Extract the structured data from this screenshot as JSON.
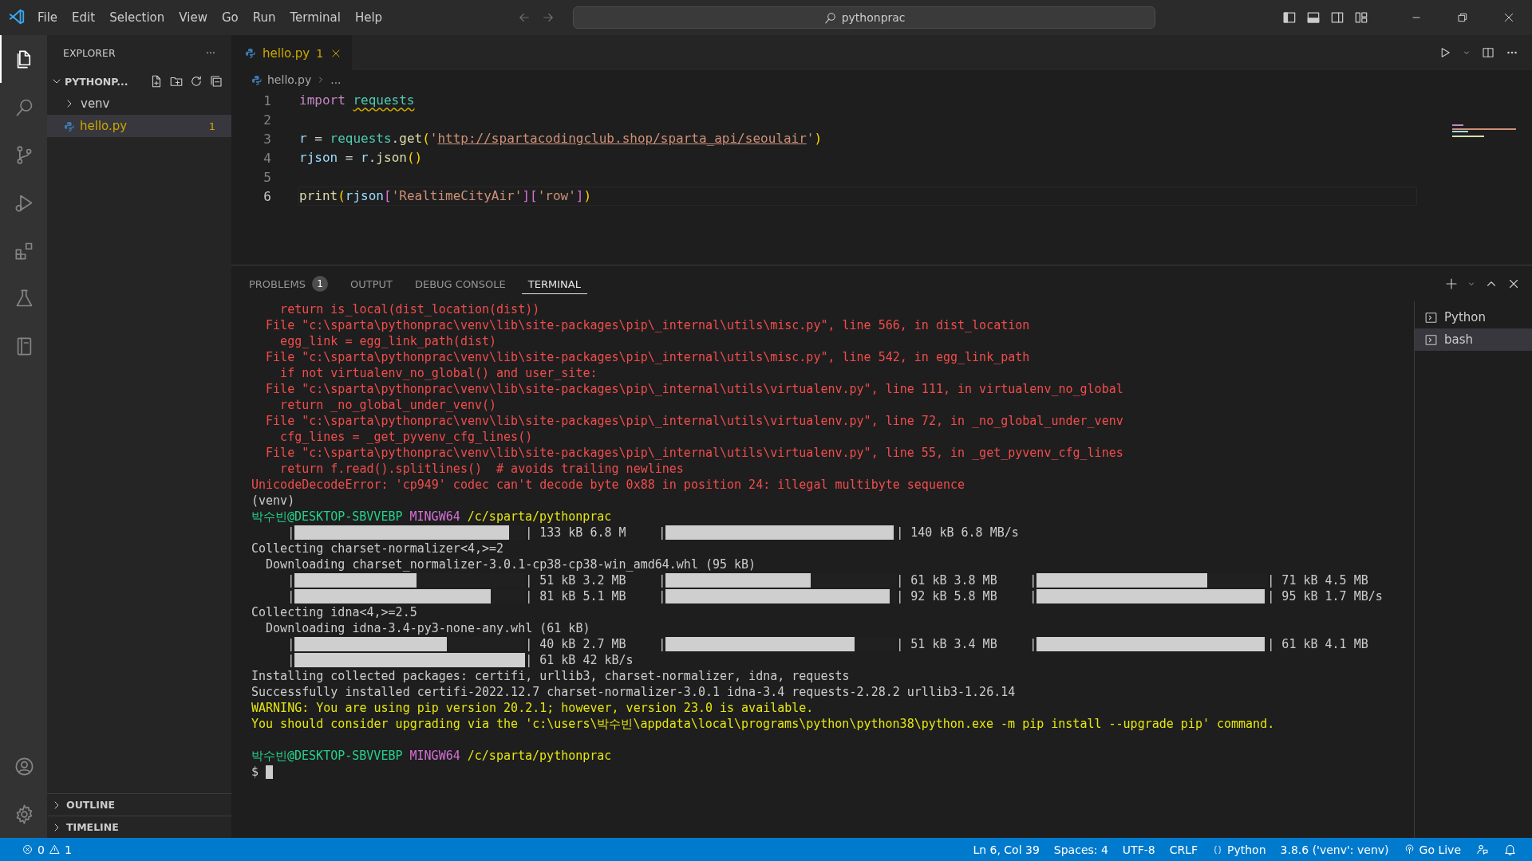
{
  "title_bar": {
    "menu": [
      "File",
      "Edit",
      "Selection",
      "View",
      "Go",
      "Run",
      "Terminal",
      "Help"
    ],
    "search": "pythonprac"
  },
  "activity_bar": {
    "top": [
      {
        "kind": "files",
        "selected": true
      },
      {
        "kind": "search",
        "selected": false
      },
      {
        "kind": "source-control",
        "selected": false
      },
      {
        "kind": "run-debug",
        "selected": false
      },
      {
        "kind": "extensions",
        "selected": false
      },
      {
        "kind": "testing",
        "selected": false
      },
      {
        "kind": "notebook",
        "selected": false
      }
    ],
    "bottom": [
      {
        "kind": "account",
        "selected": false
      },
      {
        "kind": "settings",
        "selected": false
      }
    ]
  },
  "sidebar": {
    "title": "EXPLORER",
    "more": "···",
    "folder": {
      "name": "PYTHONP...",
      "expanded": true
    },
    "tree": [
      {
        "name": "venv",
        "kind": "folder",
        "expanded": false,
        "selected": false
      },
      {
        "name": "hello.py",
        "kind": "python",
        "selected": true,
        "badge": "1"
      }
    ],
    "sections": [
      {
        "name": "OUTLINE",
        "expanded": false
      },
      {
        "name": "TIMELINE",
        "expanded": false
      }
    ]
  },
  "tabs": [
    {
      "label": "hello.py",
      "badge": "1",
      "selected": true
    }
  ],
  "breadcrumb": [
    "hello.py",
    "..."
  ],
  "editor": {
    "lines": [
      {
        "number": "1",
        "selected": false,
        "tokens": [
          {
            "text": "import ",
            "kind": "kw",
            "squiggle": false
          },
          {
            "text": "requests",
            "kind": "module",
            "squiggle": true
          }
        ]
      },
      {
        "number": "2",
        "selected": false
      },
      {
        "number": "3",
        "selected": false,
        "tokens": [
          {
            "text": "r",
            "kind": "var"
          },
          {
            "text": " = ",
            "kind": "plain"
          },
          {
            "text": "requests",
            "kind": "module"
          },
          {
            "text": ".",
            "kind": "plain"
          },
          {
            "text": "get",
            "kind": "fn"
          },
          {
            "text": "(",
            "kind": "bracket"
          },
          {
            "text": "'",
            "kind": "str"
          },
          {
            "text": "http://spartacodingclub.shop/sparta_api/seoulair",
            "kind": "link"
          },
          {
            "text": "'",
            "kind": "str"
          },
          {
            "text": ")",
            "kind": "bracket"
          }
        ]
      },
      {
        "number": "4",
        "selected": false,
        "tokens": [
          {
            "text": "rjson",
            "kind": "var"
          },
          {
            "text": " = ",
            "kind": "plain"
          },
          {
            "text": "r",
            "kind": "var"
          },
          {
            "text": ".",
            "kind": "plain"
          },
          {
            "text": "json",
            "kind": "fn"
          },
          {
            "text": "()",
            "kind": "bracket"
          }
        ]
      },
      {
        "number": "5",
        "selected": false
      },
      {
        "number": "6",
        "selected": true,
        "tokens": [
          {
            "text": "print",
            "kind": "fn"
          },
          {
            "text": "(",
            "kind": "bracket"
          },
          {
            "text": "rjson",
            "kind": "var"
          },
          {
            "text": "[",
            "kind": "bracket2"
          },
          {
            "text": "'RealtimeCityAir'",
            "kind": "str"
          },
          {
            "text": "][",
            "kind": "bracket2"
          },
          {
            "text": "'row'",
            "kind": "str"
          },
          {
            "text": "]",
            "kind": "bracket2"
          },
          {
            "text": ")",
            "kind": "bracket"
          }
        ]
      }
    ]
  },
  "panel": {
    "tabs": [
      {
        "label": "PROBLEMS",
        "badge": "1",
        "selected": false
      },
      {
        "label": "OUTPUT",
        "selected": false
      },
      {
        "label": "DEBUG CONSOLE",
        "selected": false
      },
      {
        "label": "TERMINAL",
        "selected": true
      }
    ],
    "terminal": {
      "lines": [
        {
          "kind": "error",
          "text": "    return is_local(dist_location(dist))"
        },
        {
          "kind": "error",
          "text": "  File \"c:\\sparta\\pythonprac\\venv\\lib\\site-packages\\pip\\_internal\\utils\\misc.py\", line 566, in dist_location"
        },
        {
          "kind": "error",
          "text": "    egg_link = egg_link_path(dist)"
        },
        {
          "kind": "error",
          "text": "  File \"c:\\sparta\\pythonprac\\venv\\lib\\site-packages\\pip\\_internal\\utils\\misc.py\", line 542, in egg_link_path"
        },
        {
          "kind": "error",
          "text": "    if not virtualenv_no_global() and user_site:"
        },
        {
          "kind": "error",
          "text": "  File \"c:\\sparta\\pythonprac\\venv\\lib\\site-packages\\pip\\_internal\\utils\\virtualenv.py\", line 111, in virtualenv_no_global"
        },
        {
          "kind": "error",
          "text": "    return _no_global_under_venv()"
        },
        {
          "kind": "error",
          "text": "  File \"c:\\sparta\\pythonprac\\venv\\lib\\site-packages\\pip\\_internal\\utils\\virtualenv.py\", line 72, in _no_global_under_venv"
        },
        {
          "kind": "error",
          "text": "    cfg_lines = _get_pyvenv_cfg_lines()"
        },
        {
          "kind": "error",
          "text": "  File \"c:\\sparta\\pythonprac\\venv\\lib\\site-packages\\pip\\_internal\\utils\\virtualenv.py\", line 55, in _get_pyvenv_cfg_lines"
        },
        {
          "kind": "error",
          "text": "    return f.read().splitlines()  # avoids trailing newlines"
        },
        {
          "kind": "error",
          "text": "UnicodeDecodeError: 'cp949' codec can't decode byte 0x88 in position 24: illegal multibyte sequence"
        },
        {
          "kind": "plain",
          "text": "(venv)"
        },
        {
          "kind": "prompt",
          "user": "박수빈@DESKTOP-SBVVEBP",
          "shell": "MINGW64",
          "path": "/c/sparta/pythonprac"
        },
        {
          "kind": "progress",
          "segments": [
            {
              "left": "|",
              "level": 0.93,
              "text": "| 133 kB 6.8 M"
            },
            {
              "left": "|",
              "level": 0.99,
              "text": "| 140 kB 6.8 MB/s"
            }
          ]
        },
        {
          "kind": "plain",
          "text": "Collecting charset-normalizer<4,>=2"
        },
        {
          "kind": "plain",
          "text": "  Downloading charset_normalizer-3.0.1-cp38-cp38-win_amd64.whl (95 kB)"
        },
        {
          "kind": "progress",
          "segments": [
            {
              "left": "|",
              "level": 0.53,
              "text": "| 51 kB 3.2 MB"
            },
            {
              "left": "|",
              "level": 0.63,
              "text": "| 61 kB 3.8 MB"
            },
            {
              "left": "|",
              "level": 0.74,
              "text": "| 71 kB 4.5 MB"
            }
          ]
        },
        {
          "kind": "progress",
          "segments": [
            {
              "left": "|",
              "level": 0.85,
              "text": "| 81 kB 5.1 MB"
            },
            {
              "left": "|",
              "level": 0.97,
              "text": "| 92 kB 5.8 MB"
            },
            {
              "left": "|",
              "level": 0.99,
              "text": "| 95 kB 1.7 MB/s"
            }
          ]
        },
        {
          "kind": "plain",
          "text": "Collecting idna<4,>=2.5"
        },
        {
          "kind": "plain",
          "text": "  Downloading idna-3.4-py3-none-any.whl (61 kB)"
        },
        {
          "kind": "progress",
          "segments": [
            {
              "left": "|",
              "level": 0.66,
              "text": "| 40 kB 2.7 MB"
            },
            {
              "left": "|",
              "level": 0.82,
              "text": "| 51 kB 3.4 MB"
            },
            {
              "left": "|",
              "level": 0.99,
              "text": "| 61 kB 4.1 MB"
            }
          ]
        },
        {
          "kind": "progress",
          "segments": [
            {
              "left": "|",
              "level": 1,
              "text": "| 61 kB 42 kB/s"
            }
          ]
        },
        {
          "kind": "plain",
          "text": "Installing collected packages: certifi, urllib3, charset-normalizer, idna, requests"
        },
        {
          "kind": "plain",
          "text": "Successfully installed certifi-2022.12.7 charset-normalizer-3.0.1 idna-3.4 requests-2.28.2 urllib3-1.26.14"
        },
        {
          "kind": "warning",
          "text": "WARNING: You are using pip version 20.2.1; however, version 23.0 is available."
        },
        {
          "kind": "warning",
          "text": "You should consider upgrading via the 'c:\\users\\박수빈\\appdata\\local\\programs\\python\\python38\\python.exe -m pip install --upgrade pip' command."
        },
        {
          "kind": "blank"
        },
        {
          "kind": "prompt",
          "user": "박수빈@DESKTOP-SBVVEBP",
          "shell": "MINGW64",
          "path": "/c/sparta/pythonprac"
        },
        {
          "kind": "cursor",
          "text": "$"
        }
      ]
    },
    "terminals": [
      {
        "label": "Python",
        "selected": false
      },
      {
        "label": "bash",
        "selected": true
      }
    ]
  },
  "status_bar": {
    "errors": "0",
    "warnings": "1",
    "items": [
      {
        "kind": "plain",
        "text": "Ln 6, Col 39"
      },
      {
        "kind": "plain",
        "text": "Spaces: 4"
      },
      {
        "kind": "plain",
        "text": "UTF-8"
      },
      {
        "kind": "plain",
        "text": "CRLF"
      },
      {
        "kind": "language",
        "text": "Python"
      },
      {
        "kind": "plain",
        "text": "3.8.6 ('venv': venv)"
      },
      {
        "kind": "golive",
        "text": "Go Live"
      }
    ]
  }
}
